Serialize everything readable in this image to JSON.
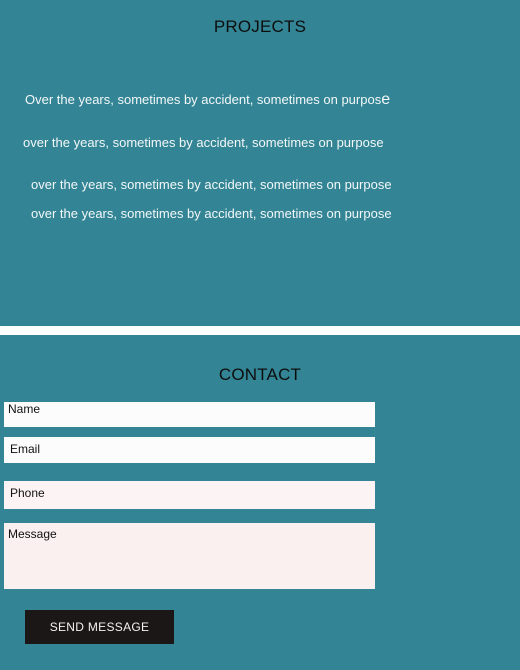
{
  "projects": {
    "title": "PROJECTS",
    "lines": [
      {
        "text": "Over the years, sometimes by accident, sometimes on purpos",
        "tail": "e"
      },
      {
        "text": "over the years, sometimes by accident, sometimes on purpose"
      },
      {
        "text": "over the years, sometimes by accident, sometimes on purpose"
      },
      {
        "text": "over the years, sometimes by accident, sometimes on purpose"
      }
    ]
  },
  "contact": {
    "title": "CONTACT",
    "fields": {
      "name_placeholder": "Name",
      "email_placeholder": "Email",
      "phone_placeholder": "Phone",
      "message_placeholder": "Message"
    },
    "submit_label": "SEND MESSAGE"
  },
  "colors": {
    "section_background": "#338595",
    "page_background": "#ffffff",
    "button_background": "#1a1716",
    "button_text": "#f2f2f2",
    "body_text": "#f3f7f8"
  }
}
